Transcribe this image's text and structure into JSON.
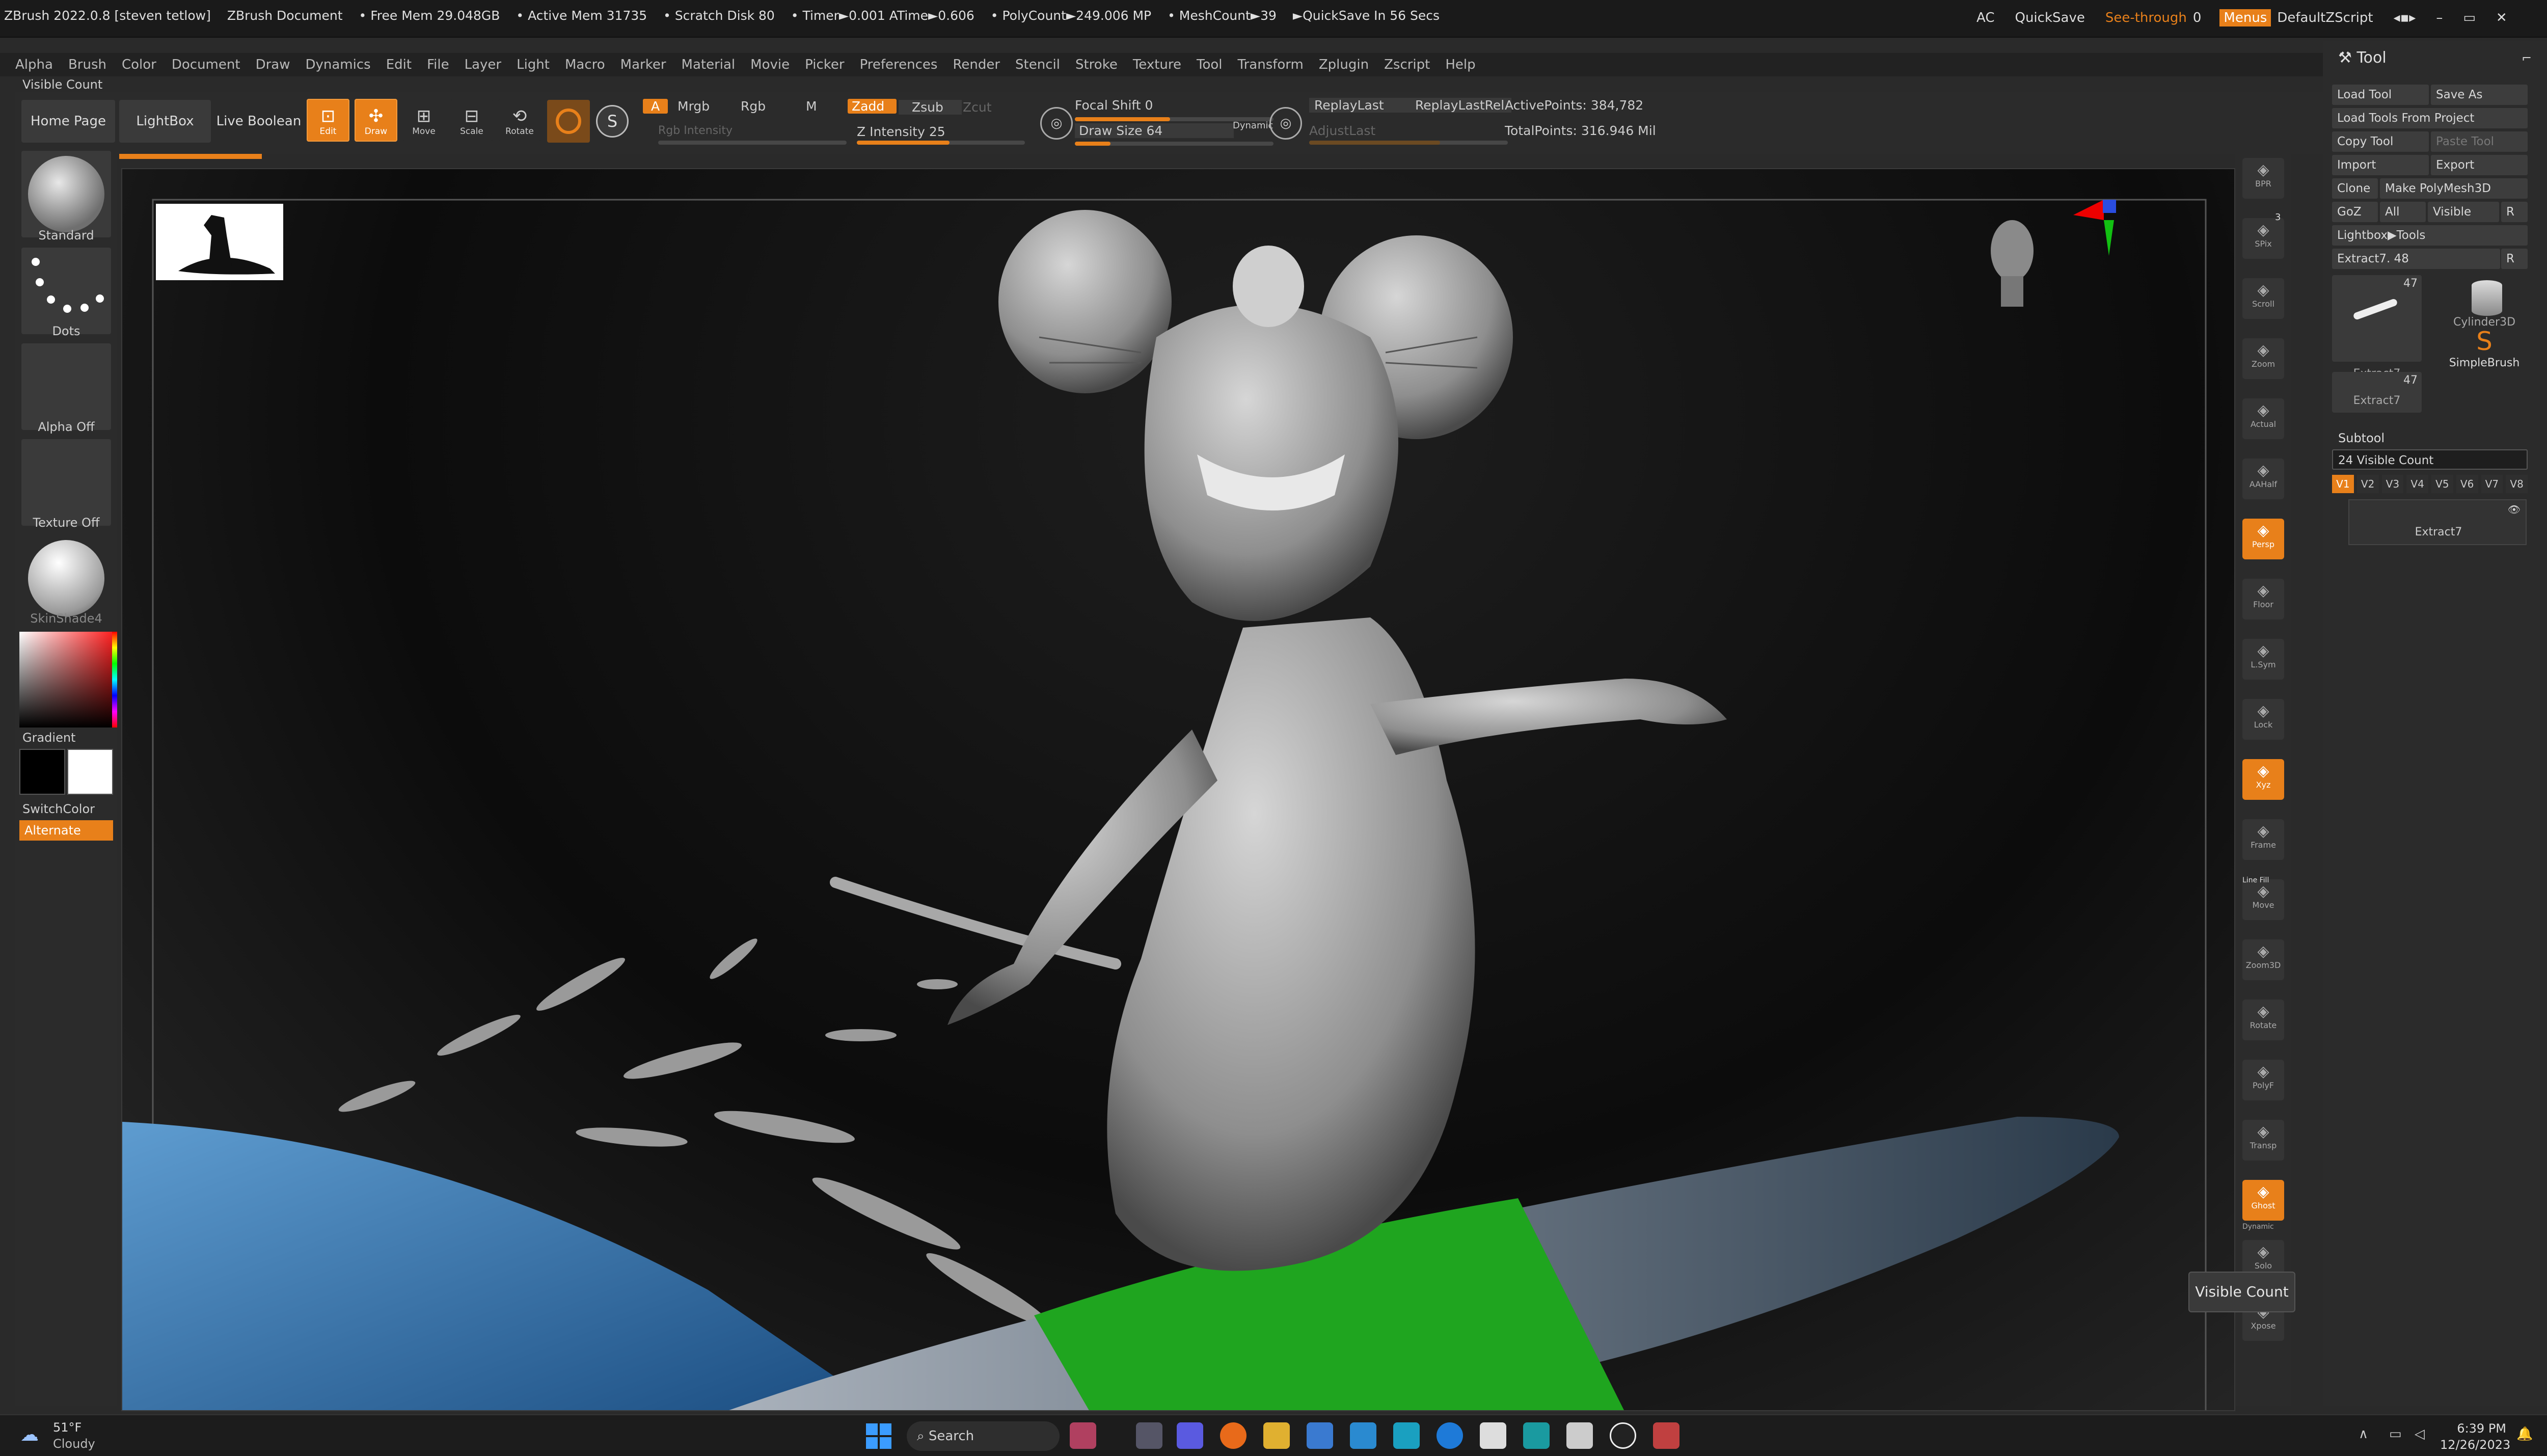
{
  "titlebar": {
    "app": "ZBrush 2022.0.8 [steven tetlow]",
    "document": "ZBrush Document",
    "free_mem": "• Free Mem 29.048GB",
    "active_mem": "• Active Mem 31735",
    "scratch": "• Scratch Disk 80",
    "timer": "• Timer►0.001 ATime►0.606",
    "polycount": "• PolyCount►249.006 MP",
    "meshcount": "• MeshCount►39",
    "quicksave_msg": "►QuickSave In 56 Secs",
    "ac": "AC",
    "quicksave": "QuickSave",
    "seethrough": "See-through",
    "seethrough_value": "0",
    "menus": "Menus",
    "script": "DefaultZScript"
  },
  "menu": [
    "Alpha",
    "Brush",
    "Color",
    "Document",
    "Draw",
    "Dynamics",
    "Edit",
    "File",
    "Layer",
    "Light",
    "Macro",
    "Marker",
    "Material",
    "Movie",
    "Picker",
    "Preferences",
    "Render",
    "Stencil",
    "Stroke",
    "Texture",
    "Tool",
    "Transform",
    "Zplugin",
    "Zscript",
    "Help"
  ],
  "visible_count_label": "Visible Count",
  "shelf": {
    "home": "Home Page",
    "lightbox": "LightBox",
    "live_boolean": "Live Boolean",
    "edit": "Edit",
    "draw": "Draw",
    "move": "Move",
    "scale": "Scale",
    "rotate": "Rotate",
    "a": "A",
    "mrgb": "Mrgb",
    "rgb": "Rgb",
    "m": "M",
    "zadd": "Zadd",
    "zsub": "Zsub",
    "zcut": "Zcut",
    "rgb_intensity": "Rgb Intensity",
    "z_intensity": "Z Intensity",
    "z_intensity_value": "25",
    "focal_shift": "Focal Shift",
    "focal_shift_value": "0",
    "draw_size": "Draw Size",
    "draw_size_value": "64",
    "dynamic": "Dynamic",
    "replay_last": "ReplayLast",
    "replay_last_rel": "ReplayLastRel",
    "adjust_last": "AdjustLast",
    "active_points": "ActivePoints: 384,782",
    "total_points": "TotalPoints: 316.946 Mil"
  },
  "leftpanel": {
    "brush": "Standard",
    "stroke": "Dots",
    "alpha": "Alpha Off",
    "texture": "Texture Off",
    "material": "SkinShade4",
    "gradient": "Gradient",
    "switchcolor": "SwitchColor",
    "alternate": "Alternate"
  },
  "rightbar": [
    "BPR",
    "SPix",
    "Scroll",
    "Zoom",
    "Actual",
    "AAHalf",
    "Persp",
    "Floor",
    "L.Sym",
    "Lock",
    "Xyz",
    "Frame",
    "Move",
    "Zoom3D",
    "Rotate",
    "PolyF",
    "Transp",
    "Ghost",
    "Solo",
    "Xpose"
  ],
  "rightbar_spix_value": "3",
  "rightbar_linefill": "Line Fill",
  "rightbar_dynamic": "Dynamic",
  "tool": {
    "header": "Tool",
    "load_tool": "Load Tool",
    "save_as": "Save As",
    "load_from_project": "Load Tools From Project",
    "copy_tool": "Copy Tool",
    "paste_tool": "Paste Tool",
    "import": "Import",
    "export": "Export",
    "clone": "Clone",
    "make_polymesh": "Make PolyMesh3D",
    "goz": "GoZ",
    "all": "All",
    "visible": "Visible",
    "r": "R",
    "lightbox_tools": "Lightbox▶Tools",
    "current": "Extract7. 48",
    "thumb1": "Extract7",
    "thumb1_count": "47",
    "thumb2": "Cylinder3D",
    "thumb3": "SimpleBrush",
    "thumb4": "Extract7",
    "thumb4_count": "47",
    "subtool": "Subtool",
    "visible_count": "24 Visible Count",
    "versions": [
      "V1",
      "V2",
      "V3",
      "V4",
      "V5",
      "V6",
      "V7",
      "V8"
    ],
    "subtool_item": "Extract7"
  },
  "tooltip": "Visible Count",
  "taskbar": {
    "temp": "51°F",
    "weather": "Cloudy",
    "search": "Search",
    "time": "6:39 PM",
    "date": "12/26/2023"
  },
  "colors": {
    "accent": "#e8801a",
    "panel": "#2b2b2b",
    "surfboard_green": "#1fa51f",
    "water_blue": "#2f6fa8"
  }
}
